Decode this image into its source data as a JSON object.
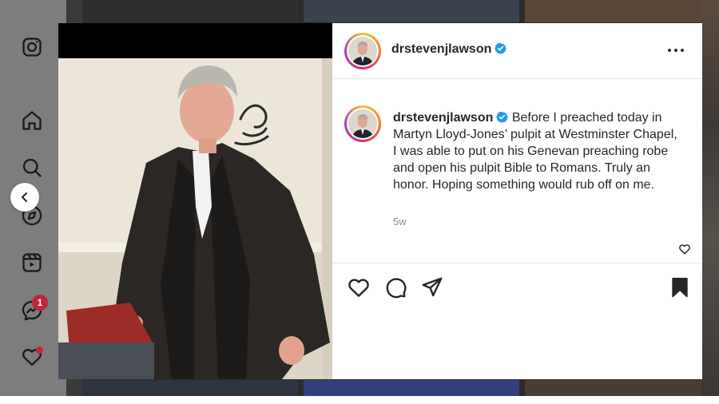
{
  "nav": {
    "icons": [
      "instagram-icon",
      "home-icon",
      "search-icon",
      "explore-icon",
      "reels-icon",
      "messenger-icon",
      "notifications-heart-icon"
    ],
    "messages_badge": "1"
  },
  "post": {
    "username": "drstevenjlawson",
    "verified": true,
    "caption": "Before I preached today in Martyn Lloyd-Jones’ pulpit at Westminster Chapel, I was able to put on his Genevan preaching robe and open his pulpit Bible to Romans. Truly an honor. Hoping something would rub off on me.",
    "timestamp": "5w"
  },
  "colors": {
    "verified": "#1d9bf0",
    "badge": "#c0253a",
    "text": "#262626",
    "muted": "#8e8e8e"
  }
}
